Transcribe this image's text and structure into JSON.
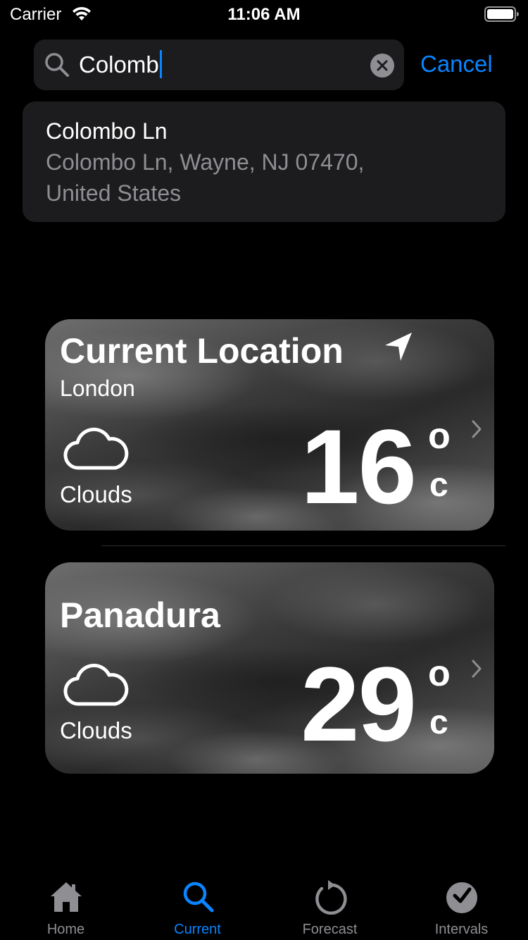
{
  "status_bar": {
    "carrier": "Carrier",
    "time": "11:06 AM",
    "icons": [
      "wifi-icon",
      "battery-icon"
    ]
  },
  "search": {
    "value": "Colomb",
    "clear_icon": "clear-icon",
    "cancel_label": "Cancel"
  },
  "suggestion": {
    "title": "Colombo Ln",
    "subtitle": "Colombo Ln, Wayne, NJ  07470, United States"
  },
  "cards": [
    {
      "title": "Current Location",
      "subtitle": "London",
      "icon": "cloud-icon",
      "condition": "Clouds",
      "temperature": "16",
      "unit_top": "o",
      "unit_bottom": "c"
    },
    {
      "title": "Panadura",
      "icon": "cloud-icon",
      "condition": "Clouds",
      "temperature": "29",
      "unit_top": "o",
      "unit_bottom": "c"
    }
  ],
  "tab_bar": {
    "tabs": [
      {
        "label": "Home",
        "icon": "home-icon"
      },
      {
        "label": "Current",
        "icon": "search-icon",
        "selected": true
      },
      {
        "label": "Forecast",
        "icon": "refresh-icon"
      },
      {
        "label": "Intervals",
        "icon": "checkmark-circle-icon"
      }
    ]
  },
  "colors": {
    "accent": "#0a84ff",
    "background": "#000000",
    "field": "#1c1c1e",
    "secondary_text": "#8e8e93"
  }
}
